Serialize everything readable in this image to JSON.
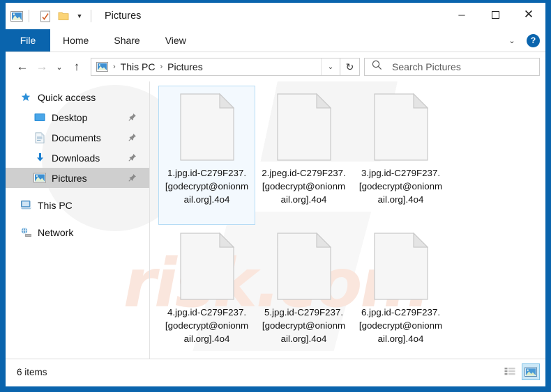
{
  "window": {
    "title": "Pictures",
    "quick_access_toolbar": [
      {
        "name": "pictures-folder-icon",
        "label": "Pictures"
      },
      {
        "name": "properties-icon",
        "label": "Properties"
      },
      {
        "name": "new-folder-icon",
        "label": "New folder"
      },
      {
        "name": "customize-dropdown-icon",
        "label": "Customize Quick Access Toolbar"
      }
    ],
    "controls": {
      "minimize": "─",
      "maximize": "☐",
      "close": "✕"
    }
  },
  "ribbon": {
    "file_tab": "File",
    "tabs": [
      "Home",
      "Share",
      "View"
    ],
    "expand_label": "⌄",
    "help_label": "?"
  },
  "navigation": {
    "back": "←",
    "forward": "→",
    "recent": "⌄",
    "up": "↑",
    "refresh": "↻",
    "breadcrumb": [
      "This PC",
      "Pictures"
    ],
    "breadcrumb_separator": "›",
    "breadcrumb_dropdown": "⌄"
  },
  "search": {
    "placeholder": "Search Pictures",
    "value": "",
    "icon": "search-icon"
  },
  "sidebar": {
    "items": [
      {
        "label": "Quick access",
        "icon": "star-pin-icon",
        "level": "root",
        "pinned": false,
        "selected": false
      },
      {
        "label": "Desktop",
        "icon": "desktop-icon",
        "level": "child",
        "pinned": true,
        "selected": false
      },
      {
        "label": "Documents",
        "icon": "documents-icon",
        "level": "child",
        "pinned": true,
        "selected": false
      },
      {
        "label": "Downloads",
        "icon": "downloads-icon",
        "level": "child",
        "pinned": true,
        "selected": false
      },
      {
        "label": "Pictures",
        "icon": "pictures-icon",
        "level": "child",
        "pinned": true,
        "selected": true
      },
      {
        "label": "This PC",
        "icon": "this-pc-icon",
        "level": "root",
        "pinned": false,
        "selected": false
      },
      {
        "label": "Network",
        "icon": "network-icon",
        "level": "root",
        "pinned": false,
        "selected": false
      }
    ]
  },
  "files": [
    {
      "name": "1.jpg.id-C279F237.[godecrypt@onionmail.org].4o4",
      "selected": true
    },
    {
      "name": "2.jpeg.id-C279F237.[godecrypt@onionmail.org].4o4",
      "selected": false
    },
    {
      "name": "3.jpg.id-C279F237.[godecrypt@onionmail.org].4o4",
      "selected": false
    },
    {
      "name": "4.jpg.id-C279F237.[godecrypt@onionmail.org].4o4",
      "selected": false
    },
    {
      "name": "5.jpg.id-C279F237.[godecrypt@onionmail.org].4o4",
      "selected": false
    },
    {
      "name": "6.jpg.id-C279F237.[godecrypt@onionmail.org].4o4",
      "selected": false
    }
  ],
  "status": {
    "item_count": "6 items",
    "views": [
      {
        "name": "details-view",
        "active": false
      },
      {
        "name": "large-icons-view",
        "active": true
      }
    ]
  },
  "watermark": {
    "text": "risk.com"
  },
  "colors": {
    "window_border": "#0a64ad",
    "file_tab": "#0a64ad",
    "selection_bg": "#f3f9fe",
    "selection_border": "#b6dcf5",
    "sidebar_selected": "#cfcfcf",
    "watermark": "#fae6dd"
  }
}
